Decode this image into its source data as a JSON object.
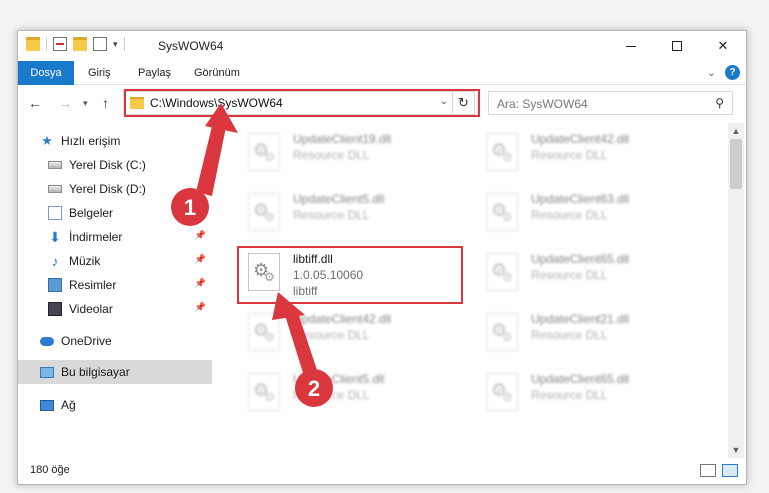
{
  "window": {
    "title": "SysWOW64",
    "quick_access_arrow": "▾"
  },
  "ribbon": {
    "tabs": [
      "Dosya",
      "Giriş",
      "Paylaş",
      "Görünüm"
    ],
    "help": "?"
  },
  "address": {
    "path": "C:\\Windows\\SysWOW64",
    "search_placeholder": "Ara: SysWOW64"
  },
  "sidebar": {
    "items": [
      {
        "label": "Hızlı erişim",
        "icon": "star-icon"
      },
      {
        "label": "Yerel Disk (C:)",
        "icon": "disk-icon"
      },
      {
        "label": "Yerel Disk (D:)",
        "icon": "disk-icon"
      },
      {
        "label": "Belgeler",
        "icon": "documents-icon"
      },
      {
        "label": "İndirmeler",
        "icon": "download-icon"
      },
      {
        "label": "Müzik",
        "icon": "music-icon"
      },
      {
        "label": "Resimler",
        "icon": "pictures-icon"
      },
      {
        "label": "Videolar",
        "icon": "videos-icon"
      },
      {
        "label": "OneDrive",
        "icon": "cloud-icon"
      },
      {
        "label": "Bu bilgisayar",
        "icon": "computer-icon"
      },
      {
        "label": "Ağ",
        "icon": "network-icon"
      }
    ]
  },
  "files": {
    "col1": [
      {
        "name": "UpdateClient19.dll",
        "sub1": "Resource DLL",
        "sub2": ""
      },
      {
        "name": "UpdateClient5.dll",
        "sub1": "Resource DLL",
        "sub2": ""
      },
      {
        "name": "libtiff.dll",
        "sub1": "1.0.05.10060",
        "sub2": "libtiff"
      },
      {
        "name": "UpdateClient42.dll",
        "sub1": "Resource DLL",
        "sub2": ""
      },
      {
        "name": "UpdateClient5.dll",
        "sub1": "Resource DLL",
        "sub2": ""
      }
    ],
    "col2": [
      {
        "name": "UpdateClient42.dll",
        "sub1": "Resource DLL",
        "sub2": ""
      },
      {
        "name": "UpdateClient63.dll",
        "sub1": "Resource DLL",
        "sub2": ""
      },
      {
        "name": "UpdateClient65.dll",
        "sub1": "Resource DLL",
        "sub2": ""
      },
      {
        "name": "UpdateClient21.dll",
        "sub1": "Resource DLL",
        "sub2": ""
      },
      {
        "name": "UpdateClient65.dll",
        "sub1": "Resource DLL",
        "sub2": ""
      }
    ]
  },
  "status": {
    "count": "180 öğe"
  },
  "annotations": {
    "badge1": "1",
    "badge2": "2",
    "color": "#d9363e"
  }
}
